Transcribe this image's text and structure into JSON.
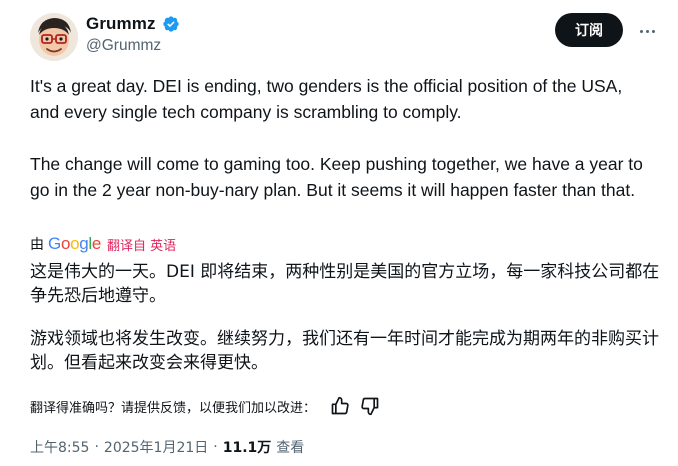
{
  "author": {
    "display_name": "Grummz",
    "handle": "@Grummz",
    "verified_icon": "verified-badge-icon",
    "avatar_icon": "cartoon-avatar"
  },
  "actions": {
    "subscribe_label": "订阅",
    "more_icon": "more-icon"
  },
  "post": {
    "paragraph_1": "It's a great day. DEI is ending, two genders is the official position of the USA, and every single tech company is scrambling to comply.",
    "paragraph_2": "The change will come to gaming too. Keep pushing together, we have a year to go in the 2 year non-buy-nary plan. But it seems it will happen faster than that."
  },
  "translation": {
    "by_label": "由",
    "provider": "Google",
    "translated_from": "翻译自 英语",
    "paragraph_1": "这是伟大的一天。DEI 即将结束，两种性别是美国的官方立场，每一家科技公司都在争先恐后地遵守。",
    "paragraph_2": "游戏领域也将发生改变。继续努力，我们还有一年时间才能完成为期两年的非购买计划。但看起来改变会来得更快。",
    "feedback_prompt": "翻译得准确吗？请提供反馈，以便我们加以改进：",
    "colors": {
      "link": "#e0245e",
      "google": [
        "#4285f4",
        "#ea4335",
        "#fbbc05",
        "#4285f4",
        "#34a853",
        "#ea4335"
      ]
    }
  },
  "meta": {
    "time": "上午8:55",
    "date": "2025年1月21日",
    "views_count": "11.1万",
    "views_label": "查看"
  }
}
